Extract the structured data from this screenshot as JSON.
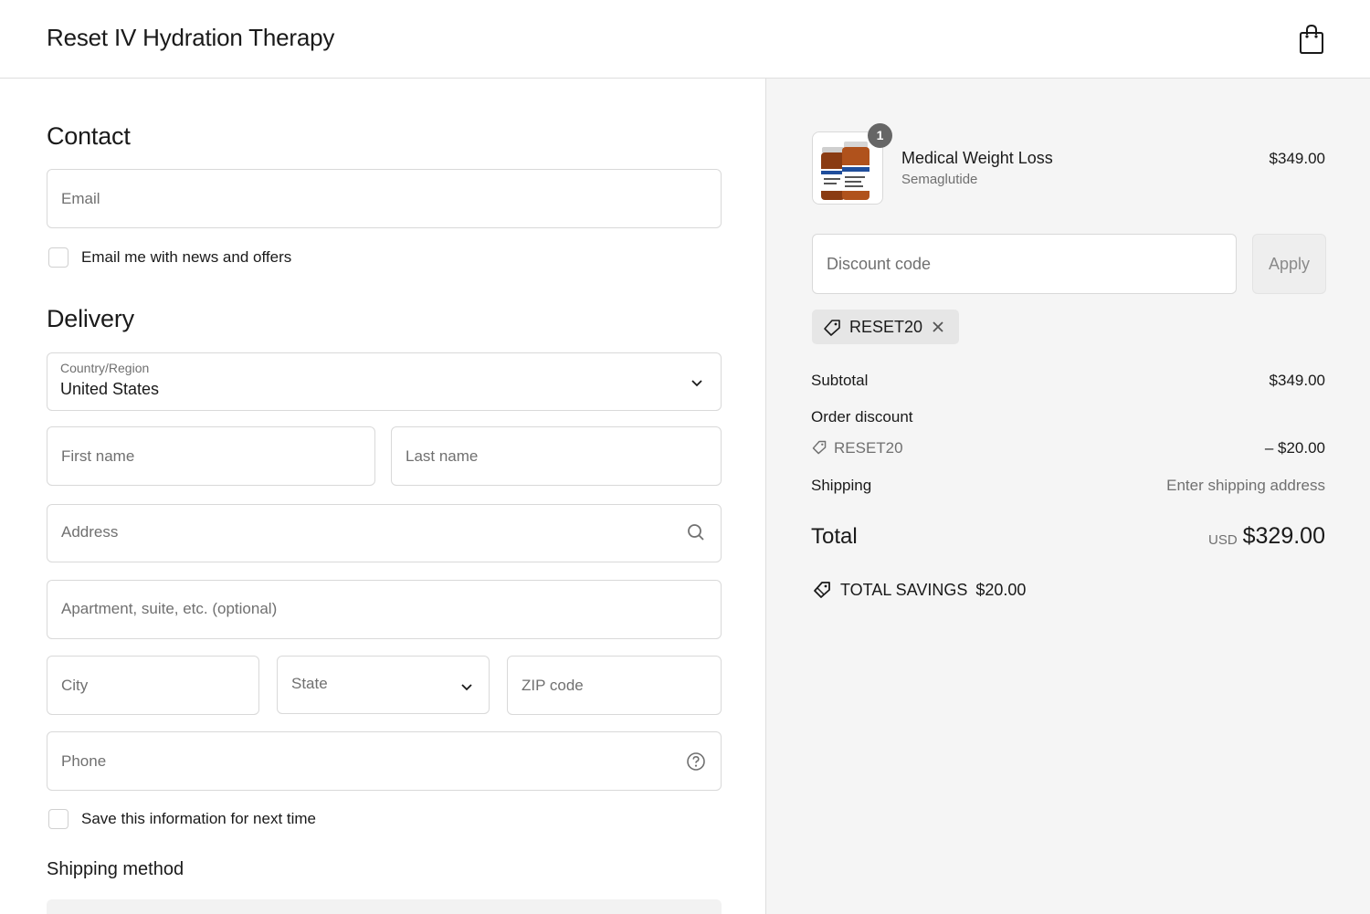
{
  "header": {
    "shop_title": "Reset IV Hydration Therapy",
    "cart_icon": "shopping-bag-icon"
  },
  "contact": {
    "heading": "Contact",
    "email_placeholder": "Email",
    "newsletter_label": "Email me with news and offers",
    "newsletter_checked": false
  },
  "delivery": {
    "heading": "Delivery",
    "country_label": "Country/Region",
    "country_value": "United States",
    "first_name_placeholder": "First name",
    "last_name_placeholder": "Last name",
    "address_placeholder": "Address",
    "apartment_placeholder": "Apartment, suite, etc. (optional)",
    "city_placeholder": "City",
    "state_placeholder": "State",
    "zip_placeholder": "ZIP code",
    "phone_placeholder": "Phone",
    "save_info_label": "Save this information for next time",
    "save_info_checked": false,
    "shipping_method_heading": "Shipping method"
  },
  "summary": {
    "product": {
      "name": "Medical Weight Loss",
      "variant": "Semaglutide",
      "price": "$349.00",
      "quantity": "1"
    },
    "discount_placeholder": "Discount code",
    "apply_label": "Apply",
    "applied_code": "RESET20",
    "subtotal_label": "Subtotal",
    "subtotal_value": "$349.00",
    "order_discount_label": "Order discount",
    "order_discount_code": "RESET20",
    "order_discount_value": "– $20.00",
    "shipping_label": "Shipping",
    "shipping_value": "Enter shipping address",
    "total_label": "Total",
    "total_currency": "USD",
    "total_value": "$329.00",
    "savings_label": "TOTAL SAVINGS",
    "savings_value": "$20.00"
  },
  "colors": {
    "border": "#d9d9d9",
    "sidebar_bg": "#f5f5f5",
    "text": "#1a1a1a",
    "muted": "#707070"
  }
}
